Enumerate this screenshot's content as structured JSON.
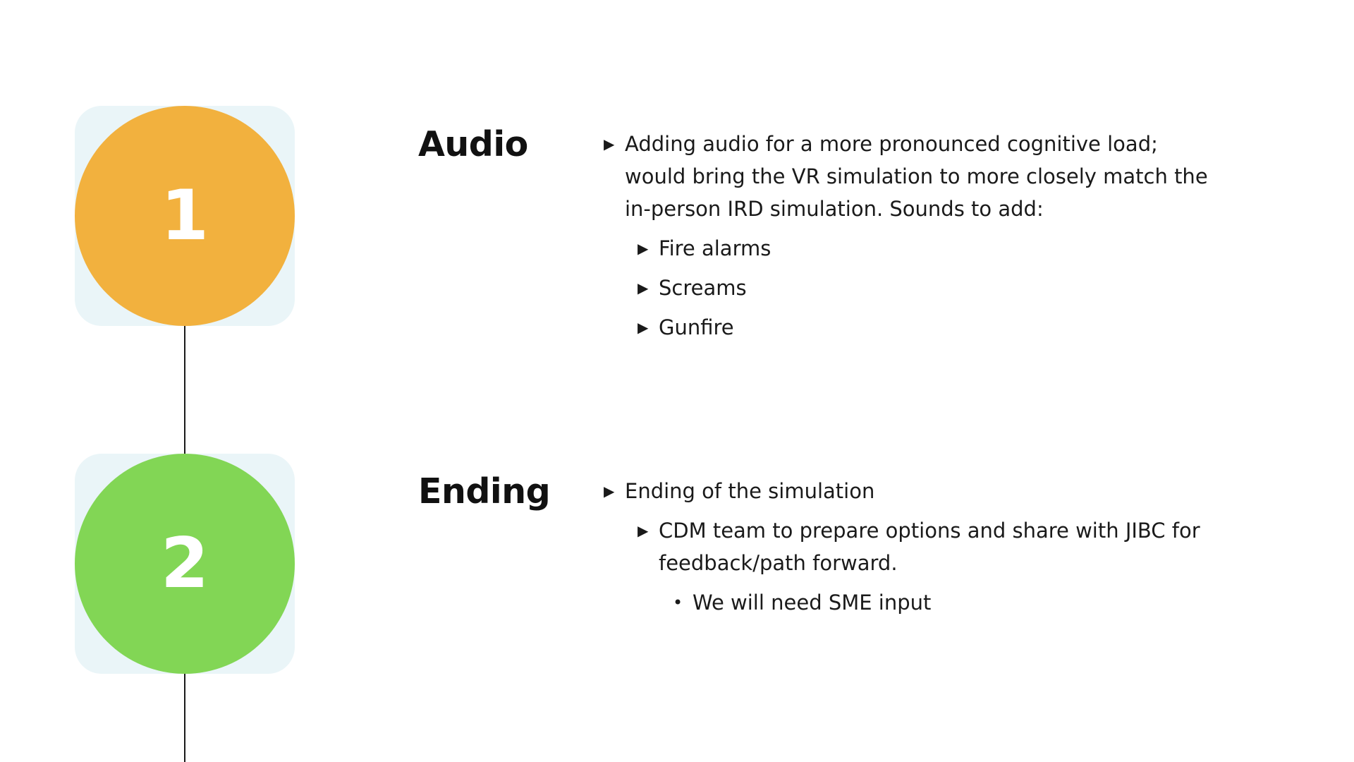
{
  "colors": {
    "step_1": "#f2b13e",
    "step_2": "#82d655",
    "card_background": "#eaf5f8",
    "line": "#1a1a1a"
  },
  "steps": [
    {
      "number": "1",
      "title": "Audio",
      "bullets": [
        {
          "level": 1,
          "marker": "triangle-right-icon",
          "text": "Adding audio for a more pronounced cognitive load; would bring the VR simulation to more closely match the in-person IRD simulation. Sounds to add:"
        },
        {
          "level": 2,
          "marker": "triangle-right-icon",
          "text": "Fire alarms"
        },
        {
          "level": 2,
          "marker": "triangle-right-icon",
          "text": "Screams"
        },
        {
          "level": 2,
          "marker": "triangle-right-icon",
          "text": "Gunfire"
        }
      ]
    },
    {
      "number": "2",
      "title": "Ending",
      "bullets": [
        {
          "level": 1,
          "marker": "triangle-right-icon",
          "text": "Ending of the simulation"
        },
        {
          "level": 2,
          "marker": "triangle-right-icon",
          "text": "CDM team to prepare options and share with JIBC for feedback/path forward."
        },
        {
          "level": 3,
          "marker": "dot-icon",
          "text": "We will need SME input"
        }
      ]
    }
  ]
}
